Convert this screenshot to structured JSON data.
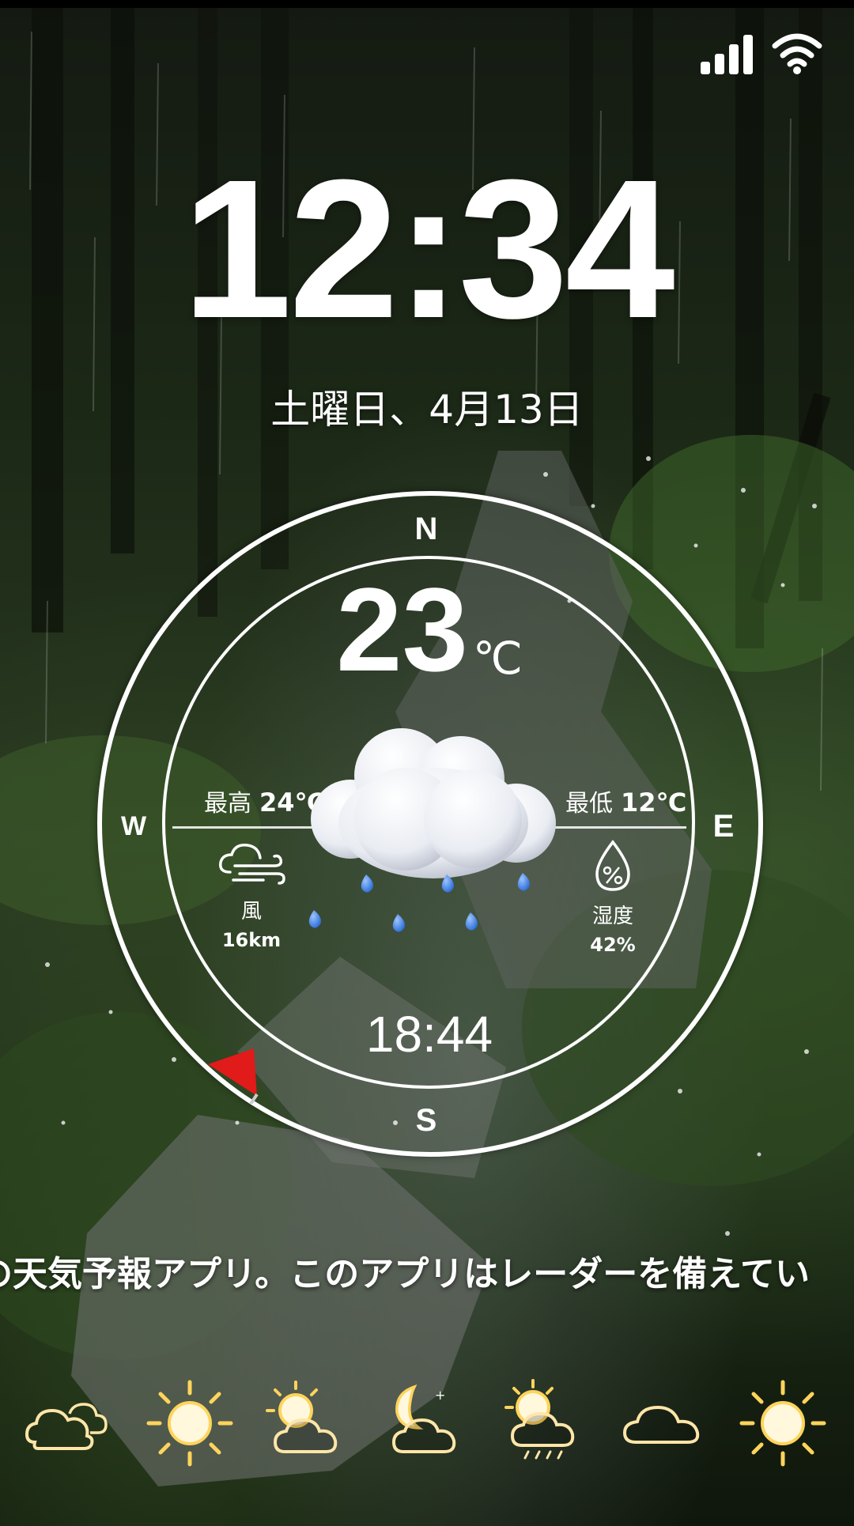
{
  "status": {
    "signal_icon": "cell-signal-icon",
    "wifi_icon": "wifi-icon"
  },
  "lock": {
    "time": "12:34",
    "date": "土曜日、4月13日"
  },
  "weather": {
    "compass": {
      "n": "N",
      "s": "S",
      "e": "E",
      "w": "W"
    },
    "temperature": "23",
    "unit": "℃",
    "high_label": "最高",
    "high_value": "24℃",
    "low_label": "最低",
    "low_value": "12℃",
    "wind_label": "風",
    "wind_value": "16km",
    "humidity_label": "湿度",
    "humidity_value": "42%",
    "sunset_time": "18:44",
    "condition_icon": "rain-cloud-icon"
  },
  "ticker": {
    "text": "の天気予報アプリ。このアプリはレーダーを備えてい"
  },
  "forecast": [
    {
      "icon": "cloudy-icon"
    },
    {
      "icon": "sunny-icon"
    },
    {
      "icon": "partly-cloudy-icon"
    },
    {
      "icon": "night-partly-cloudy-icon"
    },
    {
      "icon": "sun-rain-cloud-icon"
    },
    {
      "icon": "cloud-icon"
    },
    {
      "icon": "sunny-icon"
    }
  ],
  "colors": {
    "flag": "#e11a1a",
    "sun": "#ffd45c",
    "raindrop": "#4a8ef0"
  }
}
